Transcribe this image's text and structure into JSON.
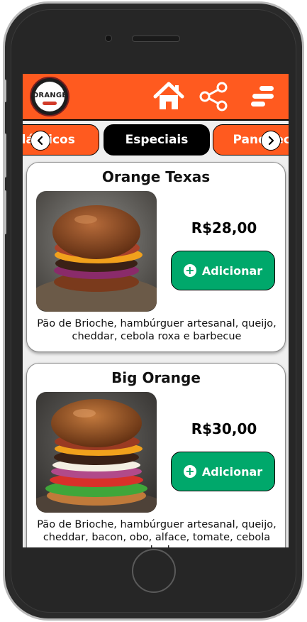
{
  "header": {
    "logo_text": "ORANGE",
    "home_icon": "home-icon",
    "share_icon": "share-icon",
    "menu_icon": "menu-icon"
  },
  "categories": {
    "items": [
      {
        "label": "Clássicos",
        "selected": false
      },
      {
        "label": "Especiais",
        "selected": true
      },
      {
        "label": "Panquecas",
        "selected": false
      }
    ],
    "prev_icon": "chevron-left-icon",
    "next_icon": "chevron-right-icon"
  },
  "products": [
    {
      "name": "Orange Texas",
      "price": "R$28,00",
      "add_label": "Adicionar",
      "description": "Pão de Brioche, hambúrguer artesanal, queijo, cheddar, cebola roxa e barbecue"
    },
    {
      "name": "Big Orange",
      "price": "R$30,00",
      "add_label": "Adicionar",
      "description": "Pão de Brioche, hambúrguer artesanal, queijo, cheddar, bacon, obo, alface, tomate, cebola roxa e barbecue"
    }
  ],
  "colors": {
    "brand_orange": "#ff5a1f",
    "add_green": "#00a86b",
    "selected_pill": "#000000"
  }
}
